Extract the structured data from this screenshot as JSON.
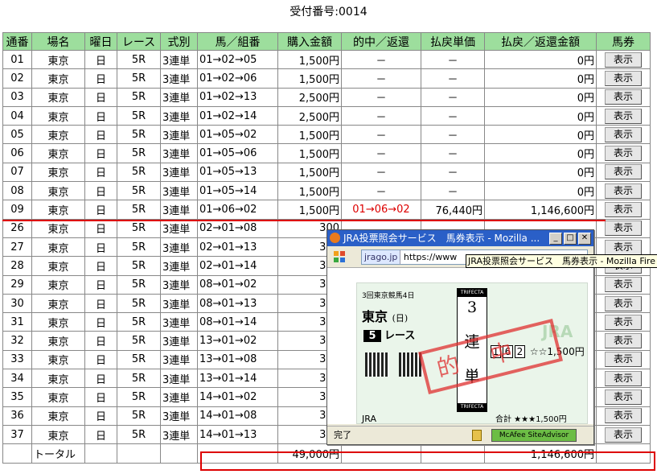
{
  "receipt_label": "受付番号:0014",
  "headers": [
    "通番",
    "場名",
    "曜日",
    "レース",
    "式別",
    "馬／組番",
    "購入金額",
    "的中／返還",
    "払戻単価",
    "払戻／返還金額",
    "馬券"
  ],
  "button_label": "表示",
  "rows": [
    {
      "no": "01",
      "place": "東京",
      "day": "日",
      "race": "5R",
      "type": "3連単",
      "combo": "01→02→05",
      "amount": "1,500円",
      "hit": "－",
      "unit": "－",
      "payout": "0円"
    },
    {
      "no": "02",
      "place": "東京",
      "day": "日",
      "race": "5R",
      "type": "3連単",
      "combo": "01→02→06",
      "amount": "1,500円",
      "hit": "－",
      "unit": "－",
      "payout": "0円"
    },
    {
      "no": "03",
      "place": "東京",
      "day": "日",
      "race": "5R",
      "type": "3連単",
      "combo": "01→02→13",
      "amount": "2,500円",
      "hit": "－",
      "unit": "－",
      "payout": "0円"
    },
    {
      "no": "04",
      "place": "東京",
      "day": "日",
      "race": "5R",
      "type": "3連単",
      "combo": "01→02→14",
      "amount": "2,500円",
      "hit": "－",
      "unit": "－",
      "payout": "0円"
    },
    {
      "no": "05",
      "place": "東京",
      "day": "日",
      "race": "5R",
      "type": "3連単",
      "combo": "01→05→02",
      "amount": "1,500円",
      "hit": "－",
      "unit": "－",
      "payout": "0円"
    },
    {
      "no": "06",
      "place": "東京",
      "day": "日",
      "race": "5R",
      "type": "3連単",
      "combo": "01→05→06",
      "amount": "1,500円",
      "hit": "－",
      "unit": "－",
      "payout": "0円"
    },
    {
      "no": "07",
      "place": "東京",
      "day": "日",
      "race": "5R",
      "type": "3連単",
      "combo": "01→05→13",
      "amount": "1,500円",
      "hit": "－",
      "unit": "－",
      "payout": "0円"
    },
    {
      "no": "08",
      "place": "東京",
      "day": "日",
      "race": "5R",
      "type": "3連単",
      "combo": "01→05→14",
      "amount": "1,500円",
      "hit": "－",
      "unit": "－",
      "payout": "0円"
    },
    {
      "no": "09",
      "place": "東京",
      "day": "日",
      "race": "5R",
      "type": "3連単",
      "combo": "01→06→02",
      "amount": "1,500円",
      "hit": "01→06→02",
      "unit": "76,440円",
      "payout": "1,146,600円",
      "win": true
    },
    {
      "no": "26",
      "place": "東京",
      "day": "日",
      "race": "5R",
      "type": "3連単",
      "combo": "02→01→08",
      "amount": "300",
      "hit": "",
      "unit": "",
      "payout": ""
    },
    {
      "no": "27",
      "place": "東京",
      "day": "日",
      "race": "5R",
      "type": "3連単",
      "combo": "02→01→13",
      "amount": "300",
      "hit": "",
      "unit": "",
      "payout": ""
    },
    {
      "no": "28",
      "place": "東京",
      "day": "日",
      "race": "5R",
      "type": "3連単",
      "combo": "02→01→14",
      "amount": "300",
      "hit": "",
      "unit": "",
      "payout": ""
    },
    {
      "no": "29",
      "place": "東京",
      "day": "日",
      "race": "5R",
      "type": "3連単",
      "combo": "08→01→02",
      "amount": "300",
      "hit": "",
      "unit": "",
      "payout": ""
    },
    {
      "no": "30",
      "place": "東京",
      "day": "日",
      "race": "5R",
      "type": "3連単",
      "combo": "08→01→13",
      "amount": "300",
      "hit": "",
      "unit": "",
      "payout": ""
    },
    {
      "no": "31",
      "place": "東京",
      "day": "日",
      "race": "5R",
      "type": "3連単",
      "combo": "08→01→14",
      "amount": "300",
      "hit": "",
      "unit": "",
      "payout": ""
    },
    {
      "no": "32",
      "place": "東京",
      "day": "日",
      "race": "5R",
      "type": "3連単",
      "combo": "13→01→02",
      "amount": "300",
      "hit": "",
      "unit": "",
      "payout": ""
    },
    {
      "no": "33",
      "place": "東京",
      "day": "日",
      "race": "5R",
      "type": "3連単",
      "combo": "13→01→08",
      "amount": "300",
      "hit": "",
      "unit": "",
      "payout": ""
    },
    {
      "no": "34",
      "place": "東京",
      "day": "日",
      "race": "5R",
      "type": "3連単",
      "combo": "13→01→14",
      "amount": "300",
      "hit": "",
      "unit": "",
      "payout": ""
    },
    {
      "no": "35",
      "place": "東京",
      "day": "日",
      "race": "5R",
      "type": "3連単",
      "combo": "14→01→02",
      "amount": "300",
      "hit": "",
      "unit": "",
      "payout": ""
    },
    {
      "no": "36",
      "place": "東京",
      "day": "日",
      "race": "5R",
      "type": "3連単",
      "combo": "14→01→08",
      "amount": "300",
      "hit": "",
      "unit": "",
      "payout": ""
    },
    {
      "no": "37",
      "place": "東京",
      "day": "日",
      "race": "5R",
      "type": "3連単",
      "combo": "14→01→13",
      "amount": "300",
      "hit": "",
      "unit": "",
      "payout": ""
    }
  ],
  "total": {
    "label": "トータル",
    "amount": "49,000円",
    "payout": "1,146,600円"
  },
  "popup": {
    "title": "JRA投票照会サービス　馬券表示 - Mozilla ...",
    "site": "jrago.jp",
    "url": "https://www",
    "tooltip": "JRA投票照会サービス　馬券表示 - Mozilla Fire",
    "status": "完了",
    "mcafee": "McAfee SiteAdvisor",
    "ticket": {
      "header": "3回東京競馬4日",
      "place": "東京",
      "day": "(日)",
      "race_no": "5",
      "race_label": "レース",
      "band_top": "TRIFECTA",
      "band_bottom": "TRIFECTA",
      "type_chars": [
        "3",
        "連",
        "単"
      ],
      "nums": [
        "1",
        "6",
        "2"
      ],
      "stars": "☆☆",
      "amount": "1,500円",
      "jra": "JRA",
      "total": "合計 ★★★1,500円",
      "stamp": "的中"
    }
  }
}
